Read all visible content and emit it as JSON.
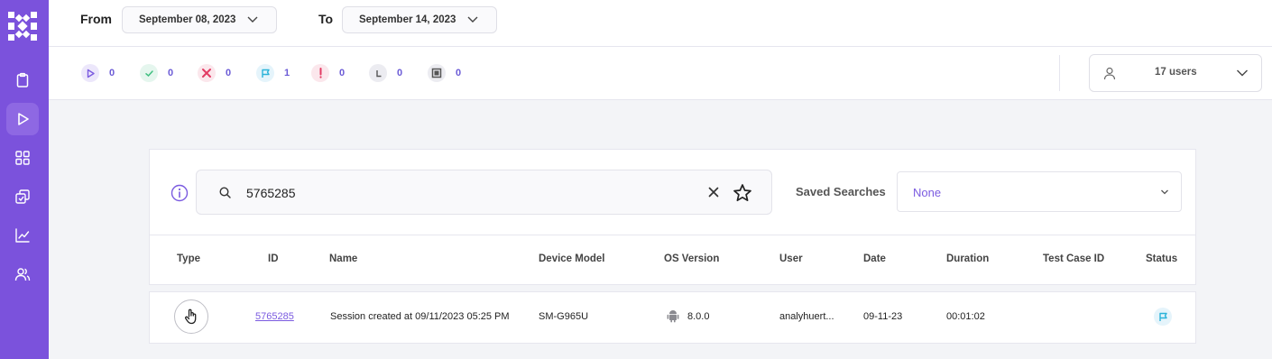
{
  "sidebar": {
    "logo": "app-logo",
    "items": [
      {
        "name": "clipboard-icon",
        "active": false
      },
      {
        "name": "play-icon",
        "active": true
      },
      {
        "name": "grid-icon",
        "active": false
      },
      {
        "name": "copy-icon",
        "active": false
      },
      {
        "name": "chart-icon",
        "active": false
      },
      {
        "name": "users-icon",
        "active": false
      }
    ]
  },
  "dates": {
    "from_label": "From",
    "from_value": "September 08, 2023",
    "to_label": "To",
    "to_value": "September 14, 2023"
  },
  "stats": [
    {
      "icon": "play-icon",
      "count": "0",
      "color": "#7b5be0"
    },
    {
      "icon": "check-icon",
      "count": "0",
      "color": "#3fbf7f"
    },
    {
      "icon": "x-icon",
      "count": "0",
      "color": "#e23b63"
    },
    {
      "icon": "flag-icon",
      "count": "1",
      "color": "#2bb3d9"
    },
    {
      "icon": "exclamation-icon",
      "count": "0",
      "color": "#e23b63"
    },
    {
      "icon": "clock-icon",
      "count": "0",
      "color": "#555"
    },
    {
      "icon": "stop-icon",
      "count": "0",
      "color": "#555"
    }
  ],
  "users_filter": {
    "label": "17 users"
  },
  "search": {
    "value": "5765285"
  },
  "saved_searches": {
    "label": "Saved Searches",
    "value": "None"
  },
  "table": {
    "headers": [
      "Type",
      "ID",
      "Name",
      "Device Model",
      "OS Version",
      "User",
      "Date",
      "Duration",
      "Test Case ID",
      "Status"
    ],
    "rows": [
      {
        "type_icon": "touch-hand-icon",
        "id": "5765285",
        "name": "Session created at 09/11/2023 05:25 PM",
        "device_model": "SM-G965U",
        "os_icon": "android-icon",
        "os_version": "8.0.0",
        "user": "analyhuert...",
        "date": "09-11-23",
        "duration": "00:01:02",
        "test_case_id": "",
        "status_icon": "flag-icon"
      }
    ]
  }
}
